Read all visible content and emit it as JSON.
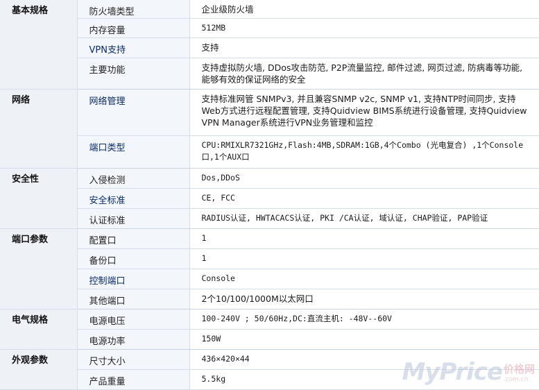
{
  "groups": [
    {
      "category": "基本规格",
      "rows": [
        {
          "label": "防火墙类型",
          "value": "企业级防火墙"
        },
        {
          "label": "内存容量",
          "value": "512MB"
        },
        {
          "label": "VPN支持",
          "value": "支持"
        },
        {
          "label": "主要功能",
          "value": "支持虚拟防火墙, DDos攻击防范, P2P流量监控, 邮件过滤, 网页过滤, 防病毒等功能, 能够有效的保证网络的安全"
        }
      ]
    },
    {
      "category": "网络",
      "rows": [
        {
          "label": "网络管理",
          "value": "支持标准网管 SNMPv3, 并且兼容SNMP v2c, SNMP v1, 支持NTP时间同步, 支持Web方式进行远程配置管理, 支持Quidview BIMS系统进行设备管理, 支持Quidview VPN Manager系统进行VPN业务管理和监控"
        },
        {
          "label": "端口类型",
          "value": "CPU:RMIXLR7321GHz,Flash:4MB,SDRAM:1GB,4个Combo (光电复合) ,1个Console口,1个AUX口"
        }
      ]
    },
    {
      "category": "安全性",
      "rows": [
        {
          "label": "入侵检测",
          "value": "Dos,DDoS"
        },
        {
          "label": "安全标准",
          "value": "CE, FCC"
        },
        {
          "label": "认证标准",
          "value": "RADIUS认证, HWTACACS认证, PKI /CA认证, 域认证, CHAP验证, PAP验证"
        }
      ]
    },
    {
      "category": "端口参数",
      "rows": [
        {
          "label": "配置口",
          "value": "1"
        },
        {
          "label": "备份口",
          "value": "1"
        },
        {
          "label": "控制端口",
          "value": "Console"
        },
        {
          "label": "其他端口",
          "value": "2个10/100/1000M以太网口"
        }
      ]
    },
    {
      "category": "电气规格",
      "rows": [
        {
          "label": "电源电压",
          "value": "100-240V ; 50/60Hz,DC:直流主机: -48V--60V"
        },
        {
          "label": "电源功率",
          "value": "150W"
        }
      ]
    },
    {
      "category": "外观参数",
      "rows": [
        {
          "label": "尺寸大小",
          "value": "436×420×44"
        },
        {
          "label": "产品重量",
          "value": "5.5kg"
        }
      ]
    }
  ],
  "watermark": {
    "brand": "MyPrice",
    "cn": "价格网",
    "domain": ".com.cn"
  }
}
